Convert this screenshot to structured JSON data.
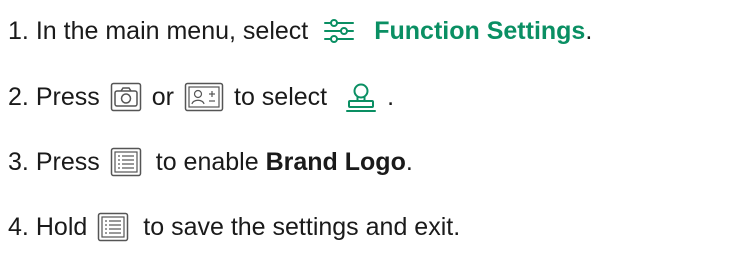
{
  "colors": {
    "accent": "#0a8f63",
    "text": "#1a1a1a",
    "icon_stroke": "#555555"
  },
  "steps": [
    {
      "number": "1.",
      "text_before": "In the main menu, select",
      "icon": "function-settings-sliders-icon",
      "bold_text": "Function Settings",
      "text_after": "."
    },
    {
      "number": "2.",
      "text_before": "Press",
      "icon_a": "camera-icon",
      "text_mid": "or",
      "icon_b": "image-adjust-icon",
      "text_mid2": "to select",
      "icon_c": "brand-logo-stamp-icon",
      "text_after": "."
    },
    {
      "number": "3.",
      "text_before": "Press",
      "icon": "menu-list-icon",
      "text_mid": "to enable",
      "bold_text": "Brand Logo",
      "text_after": "."
    },
    {
      "number": "4.",
      "text_before": "Hold",
      "icon": "menu-list-icon",
      "text_after": "to save the settings and exit."
    }
  ]
}
